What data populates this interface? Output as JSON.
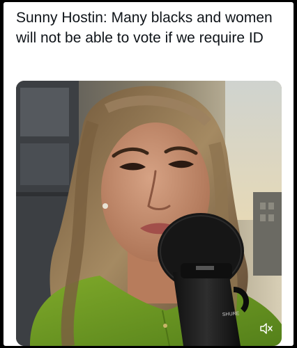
{
  "post": {
    "text": "Sunny Hostin: Many blacks and women will not be able to vote if we require ID"
  },
  "media": {
    "type": "video",
    "microphone_brand": "SHURE",
    "icons": [
      "mute-icon"
    ]
  },
  "colors": {
    "page_background": "#000000",
    "card_background": "#ffffff",
    "text": "#0f1419",
    "blouse": "#6e9a1c"
  }
}
